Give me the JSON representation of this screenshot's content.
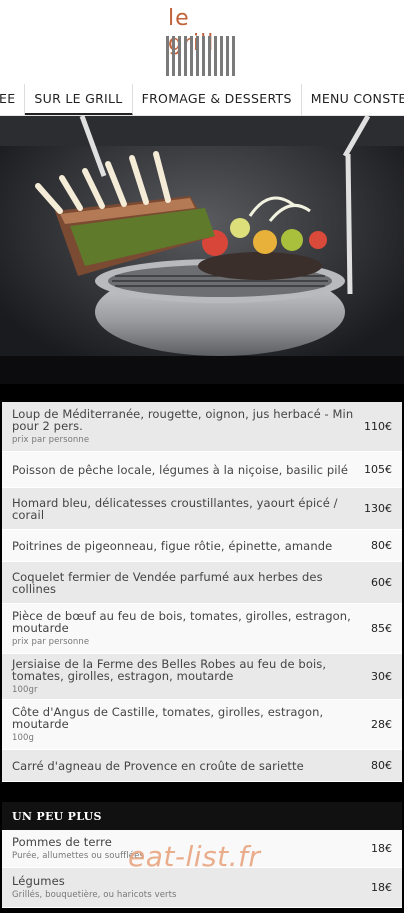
{
  "header": {
    "logo_text": "le grill"
  },
  "nav": {
    "items": [
      "EE",
      "SUR LE GRILL",
      "FROMAGE & DESSERTS",
      "MENU CONSTELL"
    ],
    "active_index": 1
  },
  "menu": [
    {
      "name": "Loup de Méditerranée, rougette, oignon, jus herbacé  - Min pour 2 pers.",
      "sub": "prix par personne",
      "price": "110€"
    },
    {
      "name": "Poisson de pêche locale, légumes à la niçoise, basilic pilé",
      "sub": "",
      "price": "105€"
    },
    {
      "name": "Homard bleu, délicatesses croustillantes, yaourt épicé / corail",
      "sub": "",
      "price": "130€"
    },
    {
      "name": "Poitrines de pigeonneau, figue rôtie, épinette, amande",
      "sub": "",
      "price": "80€"
    },
    {
      "name": "Coquelet fermier de Vendée parfumé aux herbes des collines",
      "sub": "",
      "price": "60€"
    },
    {
      "name": "Pièce de bœuf au feu de bois, tomates, girolles, estragon, moutarde",
      "sub": "prix par personne",
      "price": "85€"
    },
    {
      "name": "Jersiaise de la Ferme des Belles Robes au feu de bois, tomates, girolles, estragon, moutarde",
      "sub": "100gr",
      "price": "30€"
    },
    {
      "name": "Côte d'Angus de Castille, tomates, girolles, estragon, moutarde",
      "sub": "100g",
      "price": "28€"
    },
    {
      "name": "Carré d'agneau de Provence en croûte de sariette",
      "sub": "",
      "price": "80€"
    }
  ],
  "section_title": "UN PEU PLUS",
  "extras": [
    {
      "name": "Pommes de terre",
      "sub": "Purée, allumettes ou soufflées",
      "price": "18€"
    },
    {
      "name": "Légumes",
      "sub": "Grillés, bouquetière, ou haricots verts",
      "price": "18€"
    }
  ],
  "watermark": "eat-list.fr",
  "colors": {
    "brand": "#c0623a",
    "row_gray": "#e9e9e9",
    "row_white": "#f9f9f9"
  }
}
